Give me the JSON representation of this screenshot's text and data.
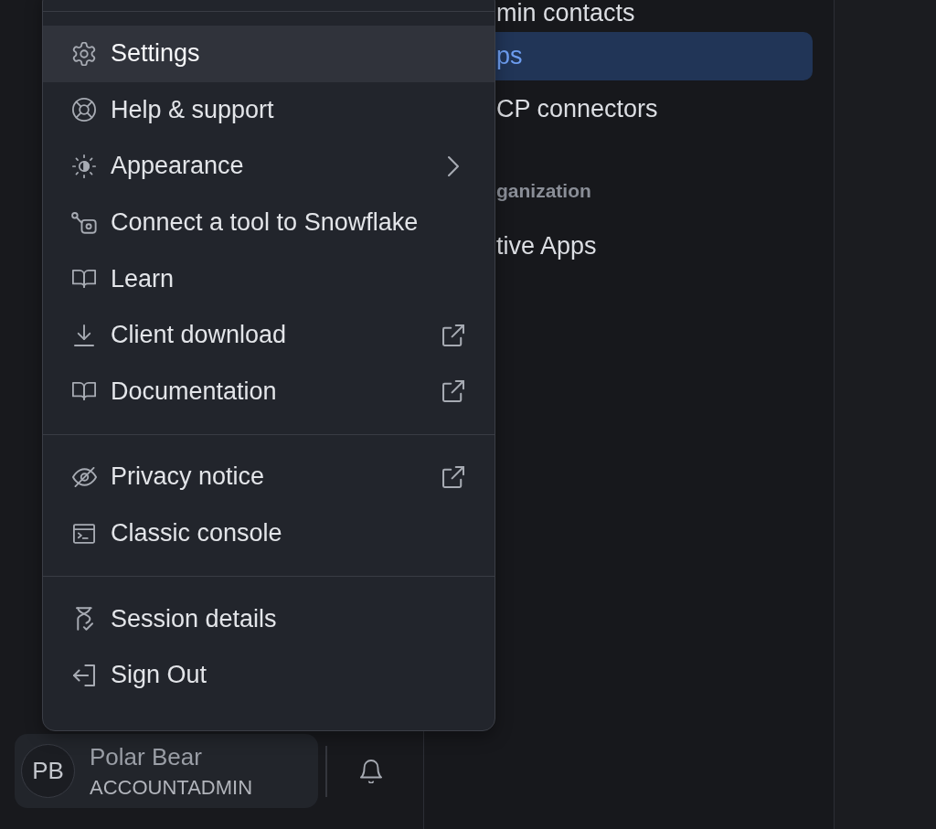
{
  "menu": {
    "groups": [
      {
        "items": [
          {
            "label": "Settings",
            "kind": "action",
            "highlighted": true
          },
          {
            "label": "Help & support",
            "kind": "action",
            "highlighted": false
          },
          {
            "label": "Appearance",
            "kind": "submenu",
            "highlighted": false
          },
          {
            "label": "Connect a tool to Snowflake",
            "kind": "action",
            "highlighted": false
          },
          {
            "label": "Learn",
            "kind": "action",
            "highlighted": false
          },
          {
            "label": "Client download",
            "kind": "external",
            "highlighted": false
          },
          {
            "label": "Documentation",
            "kind": "external",
            "highlighted": false
          }
        ]
      },
      {
        "items": [
          {
            "label": "Privacy notice",
            "kind": "external",
            "highlighted": false
          },
          {
            "label": "Classic console",
            "kind": "action",
            "highlighted": false
          }
        ]
      },
      {
        "items": [
          {
            "label": "Session details",
            "kind": "action",
            "highlighted": false
          },
          {
            "label": "Sign Out",
            "kind": "action",
            "highlighted": false
          }
        ]
      }
    ]
  },
  "nav_panel": {
    "items": [
      {
        "kind": "item",
        "label": "min contacts",
        "selected": false
      },
      {
        "kind": "item",
        "label": "ps",
        "selected": true
      },
      {
        "kind": "item",
        "label": "CP connectors",
        "selected": false
      },
      {
        "kind": "header",
        "label": "ganization"
      },
      {
        "kind": "item",
        "label": "tive Apps",
        "selected": false
      }
    ]
  },
  "user": {
    "initials": "PB",
    "name": "Polar Bear",
    "role": "ACCOUNTADMIN"
  }
}
